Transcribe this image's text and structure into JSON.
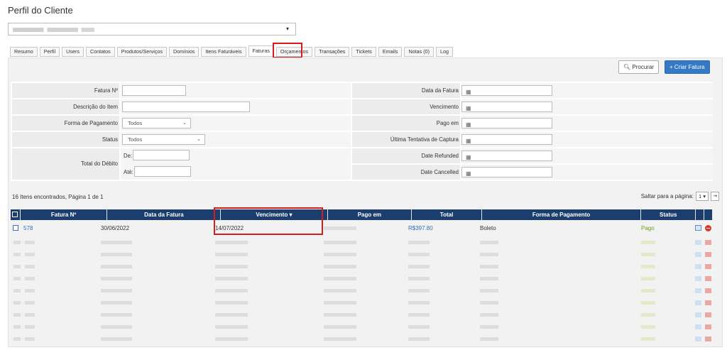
{
  "page": {
    "title": "Perfil do Cliente"
  },
  "client_select": {
    "caret": "▾"
  },
  "tabs": [
    {
      "label": "Resumo"
    },
    {
      "label": "Perfil"
    },
    {
      "label": "Users"
    },
    {
      "label": "Contatos"
    },
    {
      "label": "Produtos/Serviços"
    },
    {
      "label": "Domínios"
    },
    {
      "label": "Itens Faturáveis"
    },
    {
      "label": "Faturas",
      "active": true
    },
    {
      "label": "Orçamentos"
    },
    {
      "label": "Transações"
    },
    {
      "label": "Tickets"
    },
    {
      "label": "Emails"
    },
    {
      "label": "Notas (0)"
    },
    {
      "label": "Log"
    }
  ],
  "toolbar": {
    "search_label": "Procurar",
    "create_label": "Criar Fatura",
    "search_icon": "search-icon",
    "create_icon": "plus-icon"
  },
  "filters": {
    "invoice_no_label": "Fatura Nº",
    "item_desc_label": "Descrição do Item",
    "payment_method_label": "Forma de Pagamento",
    "payment_method_value": "Todos",
    "status_label": "Status",
    "status_value": "Todos",
    "total_due_label": "Total do Débito",
    "from_label": "De:",
    "to_label": "Até:",
    "invoice_date_label": "Data da Fatura",
    "due_label": "Vencimento",
    "paid_on_label": "Pago em",
    "last_capture_label": "Última Tentativa de Captura",
    "refunded_label": "Date Refunded",
    "cancelled_label": "Date Cancelled",
    "calendar_icon": "calendar-icon"
  },
  "results": {
    "info": "16 Itens encontrados, Página 1 de 1",
    "jump_label": "Saltar para a página:",
    "page_value": "1",
    "page_chevron": "▾",
    "last_page_glyph": "⇥"
  },
  "table": {
    "columns": [
      "Fatura Nº",
      "Data da Fatura",
      "Vencimento ▾",
      "Pago em",
      "Total",
      "Forma de Pagamento",
      "Status"
    ],
    "first_row": {
      "invoice": "578",
      "date": "30/06/2022",
      "due": "14/07/2022",
      "total": "R$397.80",
      "method": "Boleto",
      "status": "Pago"
    },
    "blurred_rows": 9
  },
  "colors": {
    "header_bg": "#1c3e6e",
    "accent": "#3479c6",
    "highlight": "#d21e1e",
    "paid": "#6a9e1f",
    "link": "#2f6db5"
  }
}
